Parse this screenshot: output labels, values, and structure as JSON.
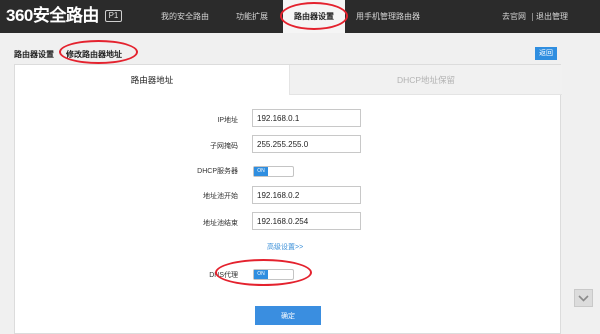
{
  "header": {
    "logo_text": "360安全路由",
    "model_badge": "P1",
    "nav": [
      {
        "label": "我的安全路由"
      },
      {
        "label": "功能扩展"
      },
      {
        "label": "路由器设置"
      },
      {
        "label": "用手机管理路由器"
      }
    ],
    "user_label": "去官网",
    "logout_label": "退出管理"
  },
  "breadcrumb": {
    "parent": "路由器设置",
    "current": "修改路由器地址"
  },
  "back_label": "返回",
  "tabs": [
    {
      "label": "路由器地址"
    },
    {
      "label": "DHCP地址保留"
    }
  ],
  "form": {
    "ip": {
      "label": "IP地址",
      "value": "192.168.0.1"
    },
    "mask": {
      "label": "子网掩码",
      "value": "255.255.255.0"
    },
    "dhcp": {
      "label": "DHCP服务器",
      "state": "ON"
    },
    "pool_start": {
      "label": "地址池开始",
      "value": "192.168.0.2"
    },
    "pool_end": {
      "label": "地址池结束",
      "value": "192.168.0.254"
    },
    "advanced_link": "高级设置>>",
    "dns_proxy": {
      "label": "DNS代理",
      "state": "ON"
    },
    "confirm": "确定"
  },
  "colors": {
    "topbar": "#2b2b2b",
    "accent_blue": "#2f8ee0",
    "annotation_red": "#e4222e"
  },
  "icons": {
    "scroll_down": "chevron-down-icon"
  }
}
